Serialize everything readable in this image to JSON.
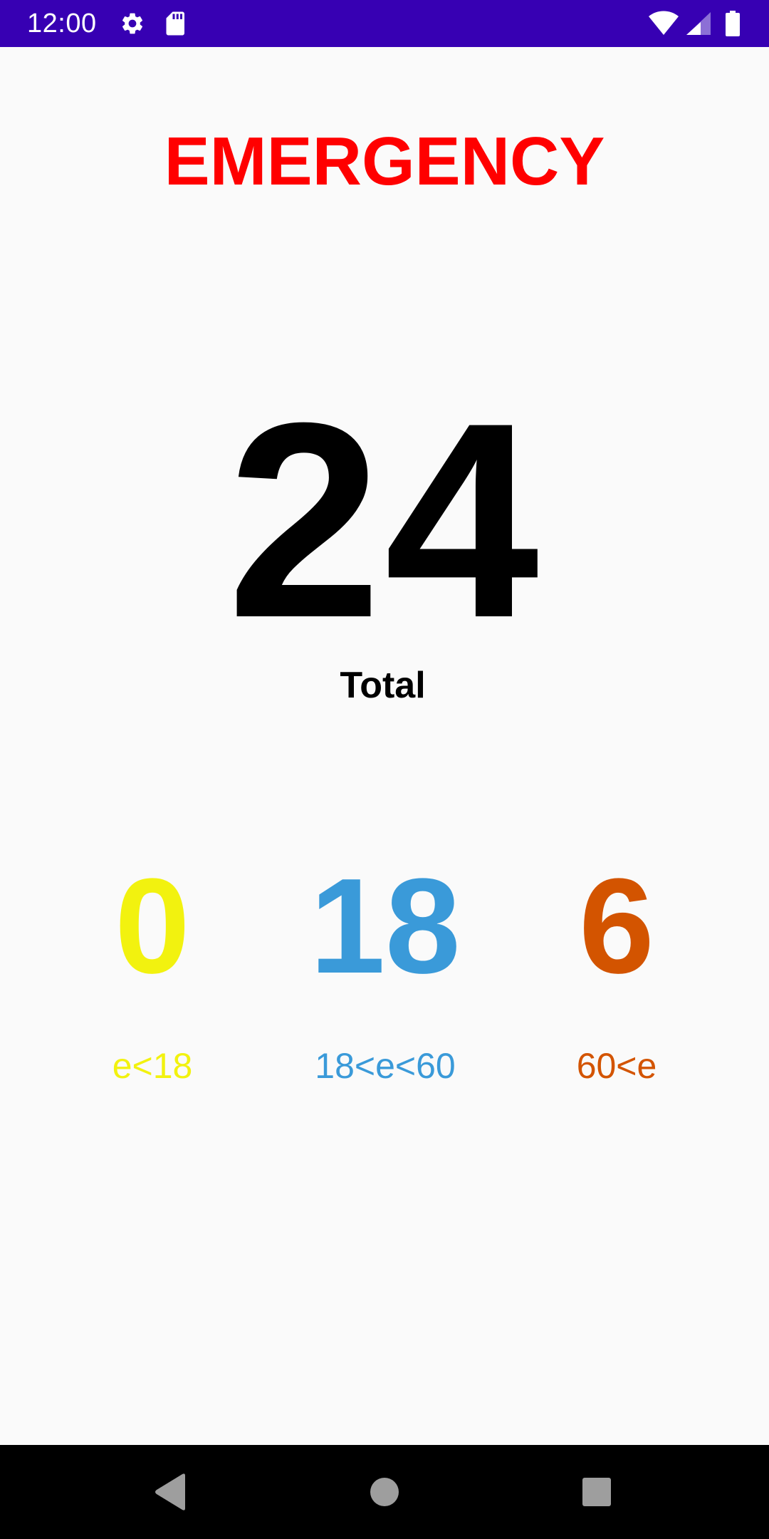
{
  "status_bar": {
    "time": "12:00",
    "icons": [
      "gear-icon",
      "sd-card-icon",
      "wifi-icon",
      "signal-icon",
      "battery-icon"
    ],
    "background_color": "#3700b3"
  },
  "title": {
    "text": "EMERGENCY",
    "color": "#ff0000"
  },
  "total": {
    "value": "24",
    "label": "Total",
    "color": "#000000"
  },
  "age_groups": [
    {
      "value": "0",
      "label": "e<18",
      "color": "#f2f20f"
    },
    {
      "value": "18",
      "label": "18<e<60",
      "color": "#3a9ad9"
    },
    {
      "value": "6",
      "label": "60<e",
      "color": "#d35400"
    }
  ],
  "nav_bar": {
    "buttons": [
      "back-icon",
      "home-icon",
      "recents-icon"
    ]
  }
}
